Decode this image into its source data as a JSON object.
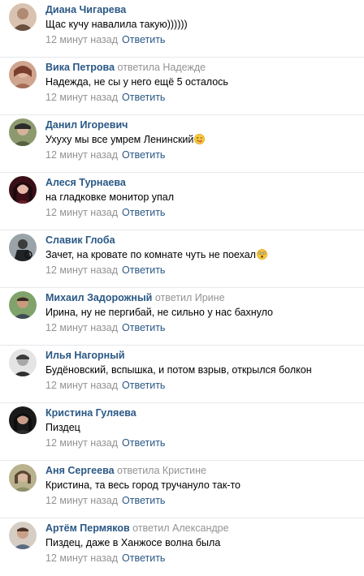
{
  "comments": [
    {
      "author": "Диана Чигарева",
      "reply_to": "",
      "text": "Щас кучу навалила такую))))))",
      "emoji": "",
      "time": "12 минут назад",
      "reply_label": "Ответить",
      "avatar_color": "#b08a73"
    },
    {
      "author": "Вика Петрова",
      "reply_to": "ответила Надежде",
      "text": "Надежда, не сы у него ещё 5 осталось",
      "emoji": "",
      "time": "12 минут назад",
      "reply_label": "Ответить",
      "avatar_color": "#a36d5a"
    },
    {
      "author": "Данил Игоревич",
      "reply_to": "",
      "text": "Ухуху мы все умрем Ленинский",
      "emoji": "winking-tongue-emoji",
      "time": "12 минут назад",
      "reply_label": "Ответить",
      "avatar_color": "#55623f"
    },
    {
      "author": "Алеся Турнаева",
      "reply_to": "",
      "text": "на гладковке монитор упал",
      "emoji": "",
      "time": "12 минут назад",
      "reply_label": "Ответить",
      "avatar_color": "#6b1f2b"
    },
    {
      "author": "Славик Глоба",
      "reply_to": "",
      "text": "Зачет, на кровате по комнате чуть не поехал",
      "emoji": "astonished-emoji",
      "time": "12 минут назад",
      "reply_label": "Ответить",
      "avatar_color": "#2a2f33"
    },
    {
      "author": "Михаил Задорожный",
      "reply_to": "ответил Ирине",
      "text": "Ирина, ну не пергибай, не сильно у нас бахнуло",
      "emoji": "",
      "time": "12 минут назад",
      "reply_label": "Ответить",
      "avatar_color": "#4d6b3d"
    },
    {
      "author": "Илья Нагорный",
      "reply_to": "",
      "text": "Будёновский, вспышка, и потом взрыв, открылся болкон",
      "emoji": "",
      "time": "12 минут назад",
      "reply_label": "Ответить",
      "avatar_color": "#7a7a7a"
    },
    {
      "author": "Кристина Гуляева",
      "reply_to": "",
      "text": "Пиздец",
      "emoji": "",
      "time": "12 минут назад",
      "reply_label": "Ответить",
      "avatar_color": "#2b2b2b"
    },
    {
      "author": "Аня Сергеева",
      "reply_to": "ответила Кристине",
      "text": "Кристина, та весь город тручануло так-то",
      "emoji": "",
      "time": "12 минут назад",
      "reply_label": "Ответить",
      "avatar_color": "#8f8f6a"
    },
    {
      "author": "Артём Пермяков",
      "reply_to": "ответил Александре",
      "text": "Пиздец, даже в Ханжосе волна была",
      "emoji": "",
      "time": "12 минут назад",
      "reply_label": "Ответить",
      "avatar_color": "#9b7b62"
    }
  ]
}
